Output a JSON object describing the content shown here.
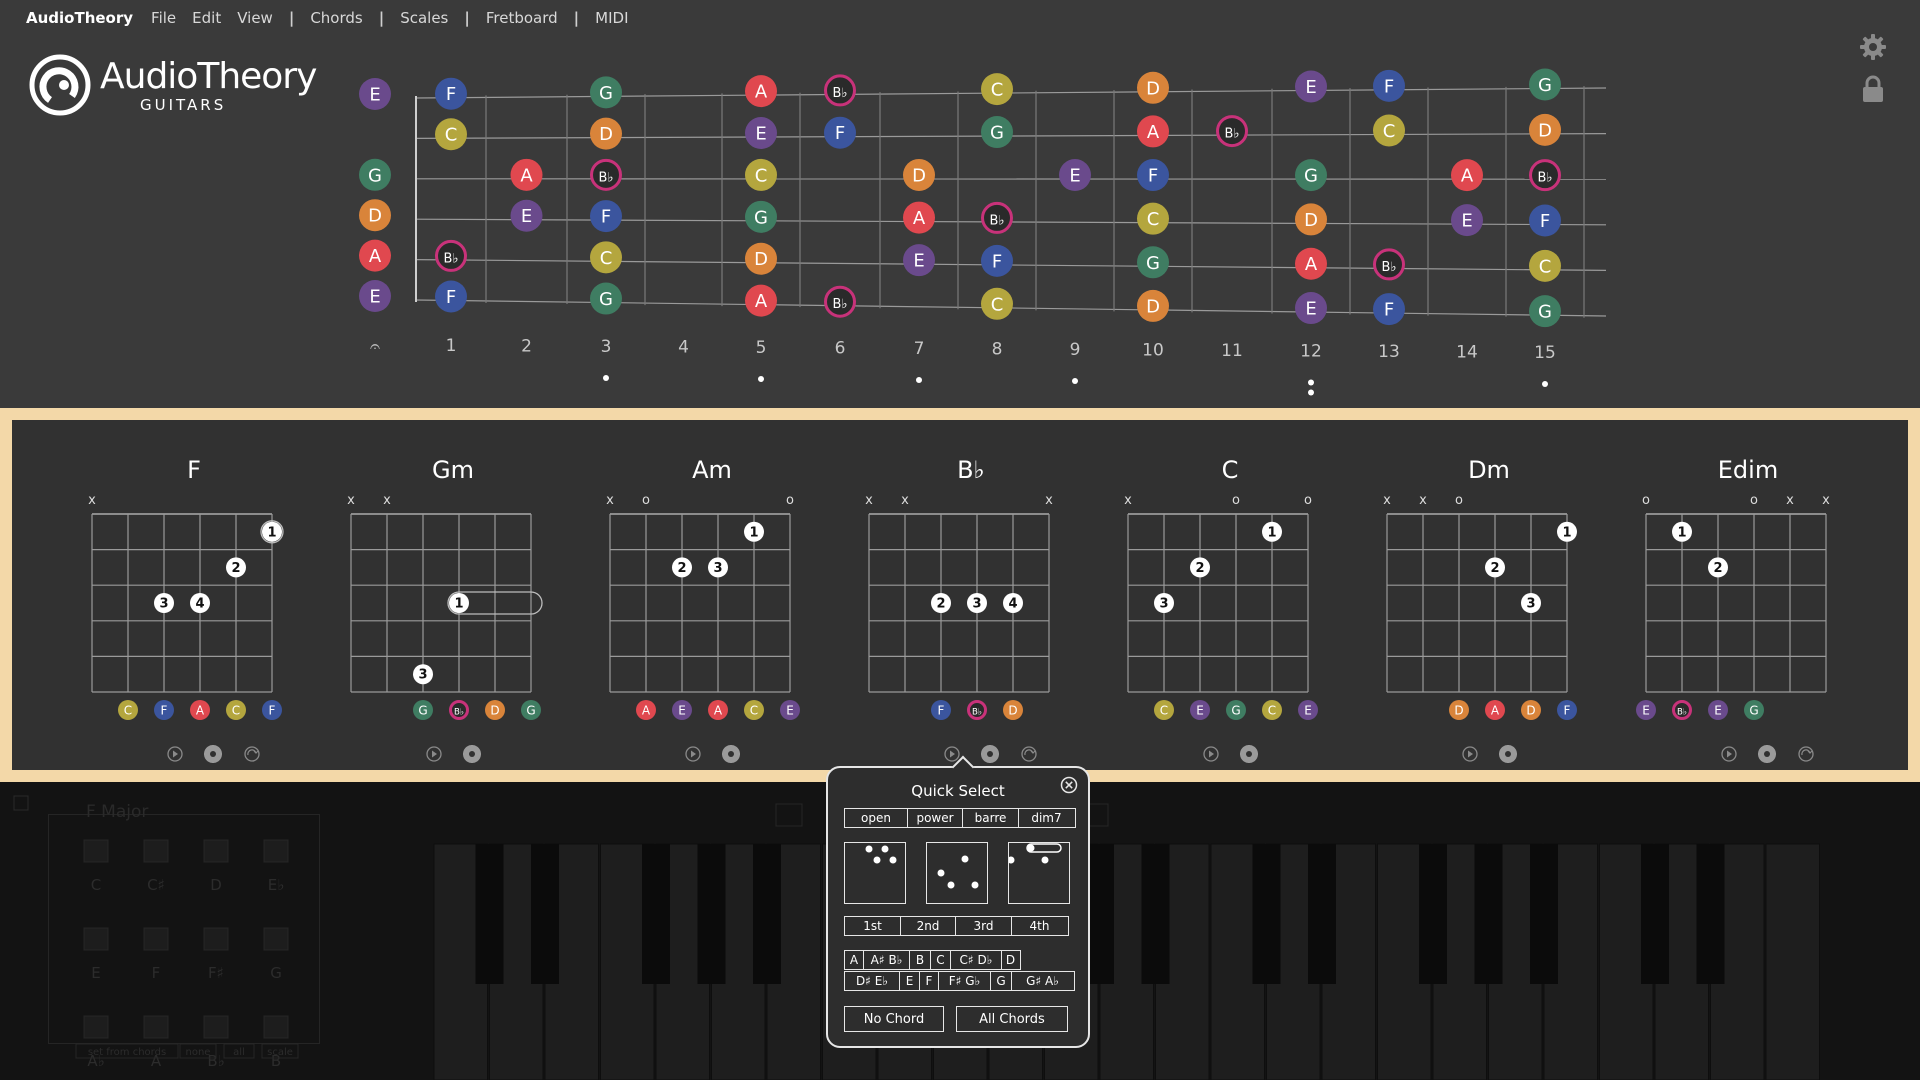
{
  "menubar": {
    "app_name": "AudioTheory",
    "file": "File",
    "edit": "Edit",
    "view": "View",
    "chords": "Chords",
    "scales": "Scales",
    "fretboard": "Fretboard",
    "midi": "MIDI",
    "separator": "|"
  },
  "logo": {
    "brand_a": "Audio",
    "brand_b": "Theory",
    "sub": "GUITARS"
  },
  "colors": {
    "E": "#6a4a8c",
    "F": "#3b559e",
    "G": "#3f7d62",
    "A": "#e0484f",
    "Bb": "#c8327a",
    "C": "#b4a63e",
    "D": "#d9843a"
  },
  "fretboard": {
    "open_label": "𝄐",
    "fret_numbers": [
      "1",
      "2",
      "3",
      "4",
      "5",
      "6",
      "7",
      "8",
      "9",
      "10",
      "11",
      "12",
      "13",
      "14",
      "15"
    ],
    "marker_frets": [
      3,
      5,
      7,
      9,
      12,
      15
    ],
    "double_marker_frets": [
      12
    ],
    "strings": [
      {
        "open": "E",
        "notes": [
          {
            "f": 1,
            "n": "F"
          },
          {
            "f": 3,
            "n": "G"
          },
          {
            "f": 5,
            "n": "A"
          },
          {
            "f": 6,
            "n": "B♭"
          },
          {
            "f": 8,
            "n": "C"
          },
          {
            "f": 10,
            "n": "D"
          },
          {
            "f": 12,
            "n": "E"
          },
          {
            "f": 13,
            "n": "F"
          },
          {
            "f": 15,
            "n": "G"
          }
        ]
      },
      {
        "open": "",
        "notes": [
          {
            "f": 1,
            "n": "C"
          },
          {
            "f": 3,
            "n": "D"
          },
          {
            "f": 5,
            "n": "E"
          },
          {
            "f": 6,
            "n": "F"
          },
          {
            "f": 8,
            "n": "G"
          },
          {
            "f": 10,
            "n": "A"
          },
          {
            "f": 11,
            "n": "B♭"
          },
          {
            "f": 13,
            "n": "C"
          },
          {
            "f": 15,
            "n": "D"
          }
        ]
      },
      {
        "open": "G",
        "notes": [
          {
            "f": 2,
            "n": "A"
          },
          {
            "f": 3,
            "n": "B♭"
          },
          {
            "f": 5,
            "n": "C"
          },
          {
            "f": 7,
            "n": "D"
          },
          {
            "f": 9,
            "n": "E"
          },
          {
            "f": 10,
            "n": "F"
          },
          {
            "f": 12,
            "n": "G"
          },
          {
            "f": 14,
            "n": "A"
          },
          {
            "f": 15,
            "n": "B♭"
          }
        ]
      },
      {
        "open": "D",
        "notes": [
          {
            "f": 2,
            "n": "E"
          },
          {
            "f": 3,
            "n": "F"
          },
          {
            "f": 5,
            "n": "G"
          },
          {
            "f": 7,
            "n": "A"
          },
          {
            "f": 8,
            "n": "B♭"
          },
          {
            "f": 10,
            "n": "C"
          },
          {
            "f": 12,
            "n": "D"
          },
          {
            "f": 14,
            "n": "E"
          },
          {
            "f": 15,
            "n": "F"
          }
        ]
      },
      {
        "open": "A",
        "notes": [
          {
            "f": 1,
            "n": "B♭"
          },
          {
            "f": 3,
            "n": "C"
          },
          {
            "f": 5,
            "n": "D"
          },
          {
            "f": 7,
            "n": "E"
          },
          {
            "f": 8,
            "n": "F"
          },
          {
            "f": 10,
            "n": "G"
          },
          {
            "f": 12,
            "n": "A"
          },
          {
            "f": 13,
            "n": "B♭"
          },
          {
            "f": 15,
            "n": "C"
          }
        ]
      },
      {
        "open": "E",
        "notes": [
          {
            "f": 1,
            "n": "F"
          },
          {
            "f": 3,
            "n": "G"
          },
          {
            "f": 5,
            "n": "A"
          },
          {
            "f": 6,
            "n": "B♭"
          },
          {
            "f": 8,
            "n": "C"
          },
          {
            "f": 10,
            "n": "D"
          },
          {
            "f": 12,
            "n": "E"
          },
          {
            "f": 13,
            "n": "F"
          },
          {
            "f": 15,
            "n": "G"
          }
        ]
      }
    ]
  },
  "chords": [
    {
      "name": "F",
      "marks": [
        "x",
        "",
        "",
        "",
        "",
        ""
      ],
      "dots": [
        {
          "s": 5,
          "fr": 1,
          "n": "1",
          "barre": true
        },
        {
          "s": 4,
          "fr": 2,
          "n": "2"
        },
        {
          "s": 2,
          "fr": 3,
          "n": "3"
        },
        {
          "s": 3,
          "fr": 3,
          "n": "4"
        }
      ],
      "notes": [
        {
          "s": 1,
          "n": "C"
        },
        {
          "s": 2,
          "n": "F"
        },
        {
          "s": 3,
          "n": "A"
        },
        {
          "s": 4,
          "n": "C"
        },
        {
          "s": 5,
          "n": "F"
        }
      ],
      "swap": true
    },
    {
      "name": "Gm",
      "marks": [
        "x",
        "x",
        "",
        "",
        "",
        ""
      ],
      "dots": [
        {
          "s": 3,
          "fr": 3,
          "n": "1",
          "barre": true
        },
        {
          "s": 2,
          "fr": 5,
          "n": "3"
        }
      ],
      "notes": [
        {
          "s": 2,
          "n": "G"
        },
        {
          "s": 3,
          "n": "B♭"
        },
        {
          "s": 4,
          "n": "D"
        },
        {
          "s": 5,
          "n": "G"
        }
      ],
      "swap": false
    },
    {
      "name": "Am",
      "marks": [
        "x",
        "o",
        "",
        "",
        "",
        "o"
      ],
      "dots": [
        {
          "s": 4,
          "fr": 1,
          "n": "1"
        },
        {
          "s": 2,
          "fr": 2,
          "n": "2"
        },
        {
          "s": 3,
          "fr": 2,
          "n": "3"
        }
      ],
      "notes": [
        {
          "s": 1,
          "n": "A"
        },
        {
          "s": 2,
          "n": "E"
        },
        {
          "s": 3,
          "n": "A"
        },
        {
          "s": 4,
          "n": "C"
        },
        {
          "s": 5,
          "n": "E"
        }
      ],
      "swap": false
    },
    {
      "name": "B♭",
      "marks": [
        "x",
        "x",
        "",
        "",
        "",
        "x"
      ],
      "dots": [
        {
          "s": 2,
          "fr": 3,
          "n": "2"
        },
        {
          "s": 3,
          "fr": 3,
          "n": "3"
        },
        {
          "s": 4,
          "fr": 3,
          "n": "4"
        }
      ],
      "notes": [
        {
          "s": 2,
          "n": "F"
        },
        {
          "s": 3,
          "n": "B♭"
        },
        {
          "s": 4,
          "n": "D"
        }
      ],
      "swap": true
    },
    {
      "name": "C",
      "marks": [
        "x",
        "",
        "",
        "o",
        "",
        "o"
      ],
      "dots": [
        {
          "s": 4,
          "fr": 1,
          "n": "1"
        },
        {
          "s": 2,
          "fr": 2,
          "n": "2"
        },
        {
          "s": 1,
          "fr": 3,
          "n": "3"
        }
      ],
      "notes": [
        {
          "s": 1,
          "n": "C"
        },
        {
          "s": 2,
          "n": "E"
        },
        {
          "s": 3,
          "n": "G"
        },
        {
          "s": 4,
          "n": "C"
        },
        {
          "s": 5,
          "n": "E"
        }
      ],
      "swap": false
    },
    {
      "name": "Dm",
      "marks": [
        "x",
        "x",
        "o",
        "",
        "",
        ""
      ],
      "dots": [
        {
          "s": 5,
          "fr": 1,
          "n": "1"
        },
        {
          "s": 3,
          "fr": 2,
          "n": "2"
        },
        {
          "s": 4,
          "fr": 3,
          "n": "3"
        }
      ],
      "notes": [
        {
          "s": 2,
          "n": "D"
        },
        {
          "s": 3,
          "n": "A"
        },
        {
          "s": 4,
          "n": "D"
        },
        {
          "s": 5,
          "n": "F"
        }
      ],
      "swap": false
    },
    {
      "name": "Edim",
      "marks": [
        "o",
        "",
        "",
        "o",
        "x",
        "x"
      ],
      "dots": [
        {
          "s": 1,
          "fr": 1,
          "n": "1"
        },
        {
          "s": 2,
          "fr": 2,
          "n": "2"
        }
      ],
      "notes": [
        {
          "s": 0,
          "n": "E"
        },
        {
          "s": 1,
          "n": "B♭"
        },
        {
          "s": 2,
          "n": "E"
        },
        {
          "s": 3,
          "n": "G"
        }
      ],
      "swap": true
    }
  ],
  "quick_select": {
    "title": "Quick Select",
    "types": [
      "open",
      "power",
      "barre",
      "dim7"
    ],
    "inversions": [
      "1st",
      "2nd",
      "3rd",
      "4th"
    ],
    "roots_row1": [
      "A",
      "A♯ B♭",
      "B",
      "C",
      "C♯ D♭",
      "D"
    ],
    "roots_row2": [
      "D♯ E♭",
      "E",
      "F",
      "F♯ G♭",
      "G",
      "G♯ A♭"
    ],
    "no_chord": "No Chord",
    "all_chords": "All Chords"
  },
  "background_panel": {
    "title": "F Major",
    "keys": [
      "C",
      "C♯",
      "D",
      "E♭",
      "E",
      "F",
      "F♯",
      "G",
      "A♭",
      "A",
      "B♭",
      "B"
    ],
    "buttons": [
      "set from chords",
      "none",
      "all",
      "scale"
    ]
  }
}
